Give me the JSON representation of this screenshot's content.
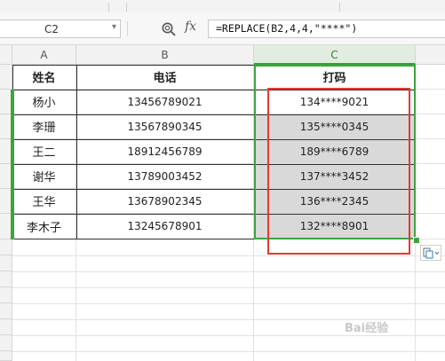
{
  "formula_bar": {
    "name_box": "C2",
    "fx_label": "fx",
    "formula": "=REPLACE(B2,4,4,\"****\")"
  },
  "columns": [
    "A",
    "B",
    "C"
  ],
  "table": {
    "headers": [
      "姓名",
      "电话",
      "打码"
    ],
    "rows": [
      [
        "杨小",
        "13456789021",
        "134****9021"
      ],
      [
        "李珊",
        "13567890345",
        "135****0345"
      ],
      [
        "王二",
        "18912456789",
        "189****6789"
      ],
      [
        "谢华",
        "13789003452",
        "137****3452"
      ],
      [
        "王华",
        "13678902345",
        "136****2345"
      ],
      [
        "李木子",
        "13245678901",
        "132****8901"
      ]
    ]
  },
  "watermark": "Bai经验",
  "colors": {
    "selection_green": "#3ea33f",
    "annotation_red": "#e53935",
    "selected_fill": "#d9d9d9"
  },
  "icons": [
    "zoom-icon",
    "dropdown-arrow-icon",
    "paste-options-icon"
  ]
}
